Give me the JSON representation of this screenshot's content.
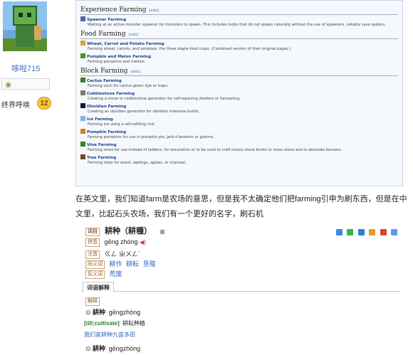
{
  "user": {
    "name": "哆啦715",
    "title": "终界呼唤",
    "level": "12"
  },
  "wiki": {
    "sections": [
      {
        "title": "Experience Farming",
        "edit": "[edit]",
        "entries": [
          {
            "name": "Spawner Farming",
            "desc": "Waiting at an active monster spawner for monsters to spawn. This includes mobs that do not spawn naturally without the use of spawners, notably cave spiders.",
            "icon_color": "#4a6aa8"
          }
        ]
      },
      {
        "title": "Food Farming",
        "edit": "[edit]",
        "entries": [
          {
            "name": "Wheat, Carrot and Potato Farming",
            "desc": "Farming wheat, carrots, and potatoes, the three staple food crops. (Combined version of their original pages.)",
            "icon_color": "#d9a43a"
          },
          {
            "name": "Pumpkin and Melon Farming",
            "desc": "Farming pumpkins and melons.",
            "icon_color": "#4f8f2f"
          }
        ]
      },
      {
        "title": "Block Farming",
        "edit": "[edit]",
        "entries": [
          {
            "name": "Cactus Farming",
            "desc": "Farming cacti for cactus green dye or traps.",
            "icon_color": "#3d7a2a"
          },
          {
            "name": "Cobblestone Farming",
            "desc": "Creating a stone or cobblestone generator for self-repairing shelters or harvesting.",
            "icon_color": "#7a7a7a"
          },
          {
            "name": "Obsidian Farming",
            "desc": "Creating an obsidian generator for obsidian intensive builds.",
            "icon_color": "#1d1530"
          },
          {
            "name": "Ice Farming",
            "desc": "Farming ice using a self-refilling rink.",
            "icon_color": "#7fb2e8"
          },
          {
            "name": "Pumpkin Farming",
            "desc": "Farming pumpkins for use in pumpkin pie, jack o'lanterns or golems.",
            "icon_color": "#d9801e"
          },
          {
            "name": "Vine Farming",
            "desc": "Farming vines for use instead of ladders, for decoration or to be used to craft mossy stone bricks or moss stone and to decorate banners.",
            "icon_color": "#3f7d2a"
          },
          {
            "name": "Tree Farming",
            "desc": "Farming trees for wood, saplings, apples, or charcoal.",
            "icon_color": "#6b4a24"
          }
        ]
      }
    ]
  },
  "paragraph": "在英文里，我们知道farm是农场的意思，但是我不太确定他们把farming引申为刷东西，但是在中文里，比起石头农场，我们有一个更好的名字，刷石机",
  "dictionary": {
    "word": "耕种（耕種）",
    "tag_word": "词目",
    "tag_pinyin": "拼音",
    "pinyin": "gēng zhòng",
    "tag_zhuyin": "注音",
    "zhuyin": "ㄍㄥ ㄓㄨㄥˋ",
    "tag_syn": "同义词",
    "synonyms": [
      "耕作",
      "耕耘",
      "垦殖"
    ],
    "tag_ant": "反义词",
    "antonyms": [
      "荒废"
    ],
    "tab": "词语解释",
    "sense_tag": "解释",
    "sense1_head": "耕种",
    "sense1_pinyin": "gēngzhòng",
    "sense1_en": "[till;cultivate]",
    "sense1_gloss": "耕耘种植",
    "sense1_example": "我们家耕种九亩多田",
    "sense2_head": "耕种",
    "sense2_pinyin": "gēngzhòng"
  }
}
